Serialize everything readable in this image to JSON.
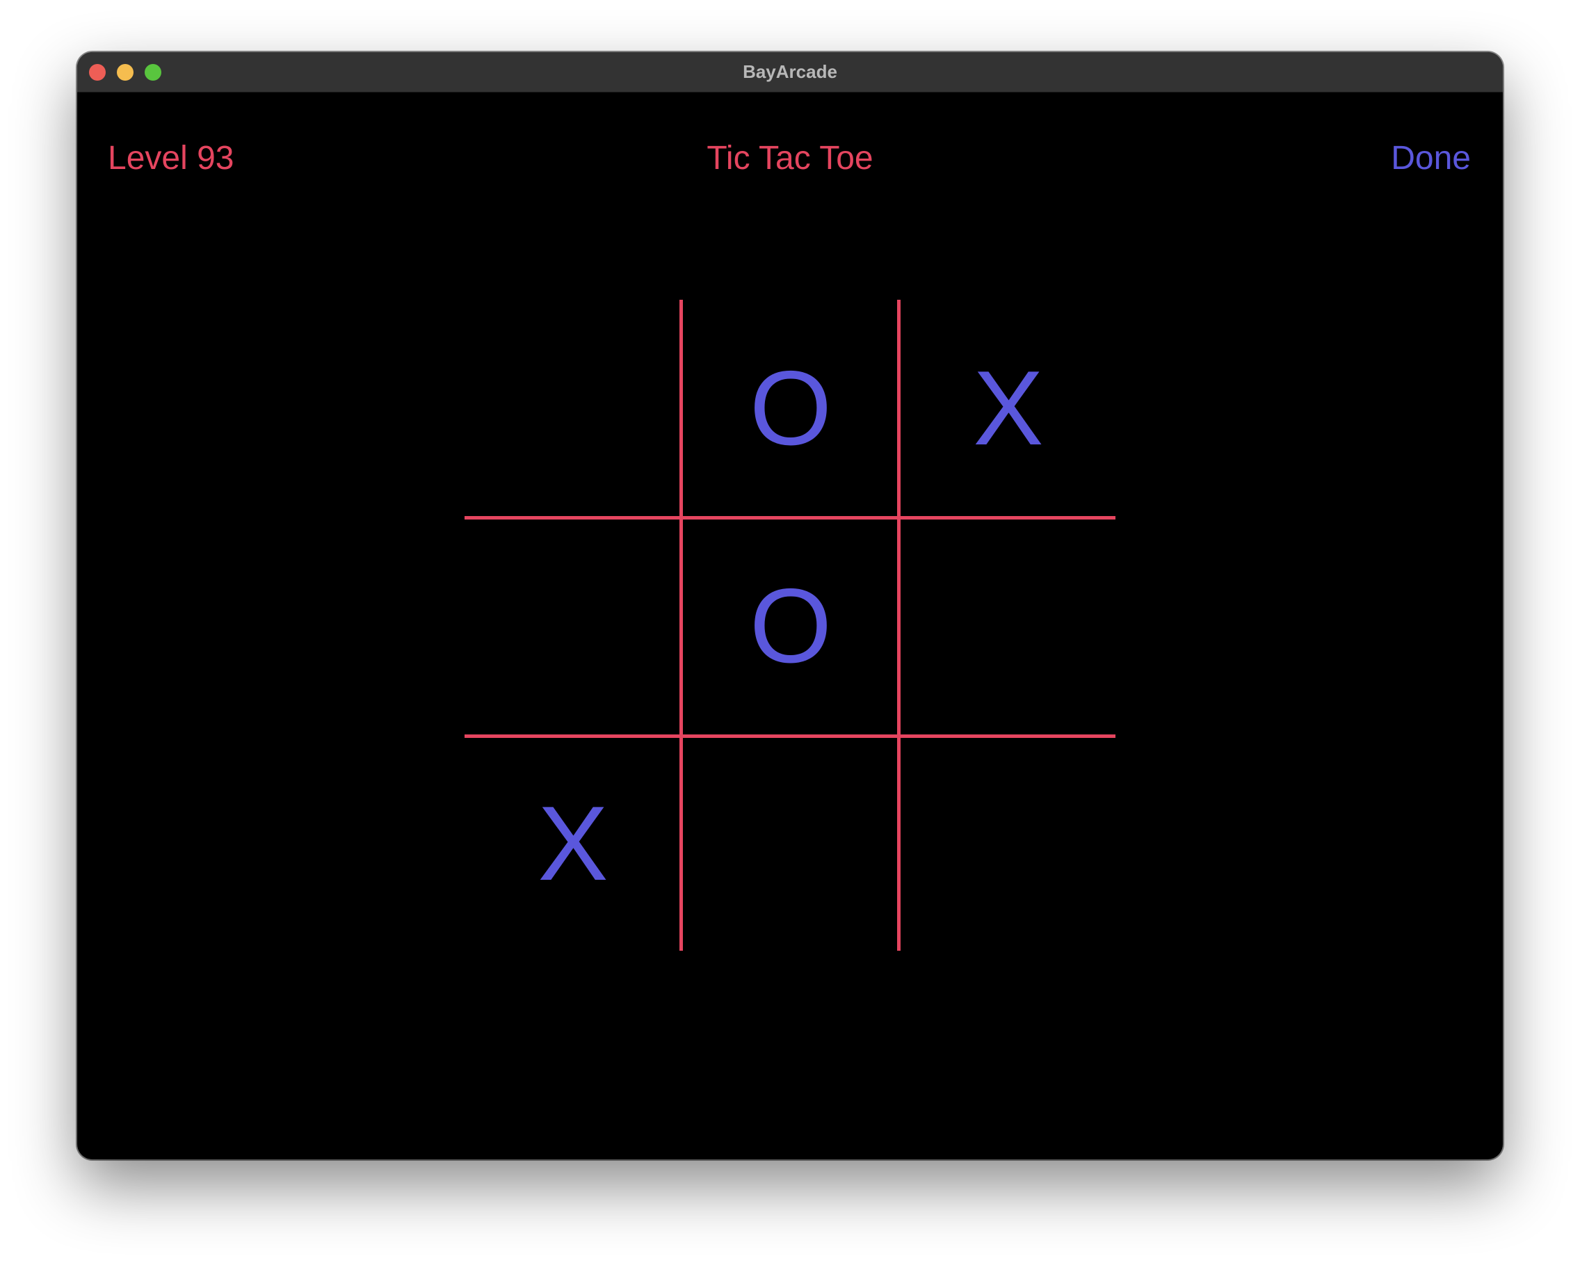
{
  "window": {
    "title": "BayArcade"
  },
  "colors": {
    "accent_red": "#e5455f",
    "accent_blue": "#5a57dc",
    "background": "#000000",
    "titlebar": "#333333",
    "traffic_close": "#ee5e56",
    "traffic_minimize": "#f5bd4f",
    "traffic_zoom": "#59c53e"
  },
  "header": {
    "level_label": "Level 93",
    "title": "Tic Tac Toe",
    "done_label": "Done"
  },
  "board": {
    "cells": [
      [
        "",
        "O",
        "X"
      ],
      [
        "",
        "O",
        ""
      ],
      [
        "X",
        "",
        ""
      ]
    ]
  }
}
